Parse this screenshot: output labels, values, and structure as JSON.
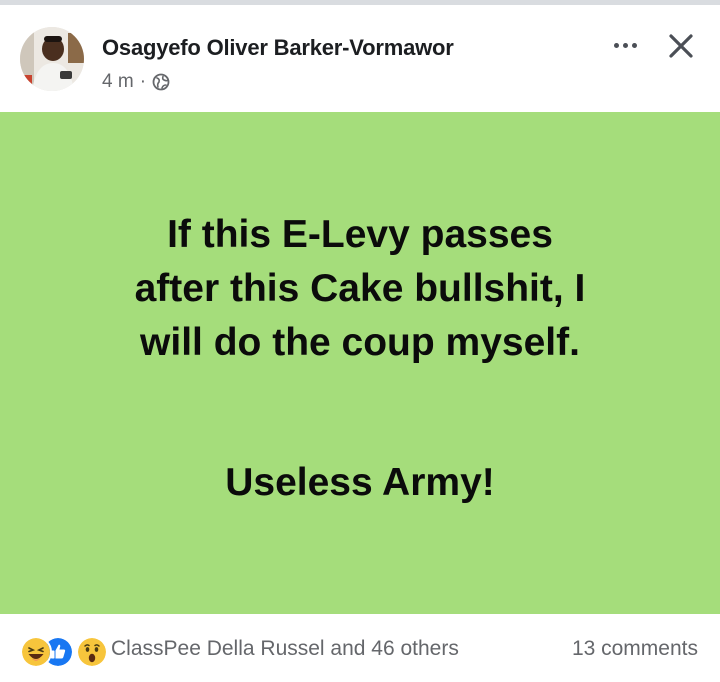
{
  "post": {
    "author": "Osagyefo Oliver Barker-Vormawor",
    "time": "4 m",
    "separator": "·",
    "audience_icon": "globe-icon",
    "text_lines": [
      "If this E-Levy passes",
      "after this Cake bullshit, I",
      "will do the coup myself."
    ],
    "closing_line": "Useless Army!",
    "background_color": "#a5dd7b"
  },
  "footer": {
    "reaction_icons": [
      "haha-icon",
      "like-icon",
      "wow-icon"
    ],
    "reactors": "ClassPee Della Russel and 46 others",
    "comments": "13 comments"
  }
}
